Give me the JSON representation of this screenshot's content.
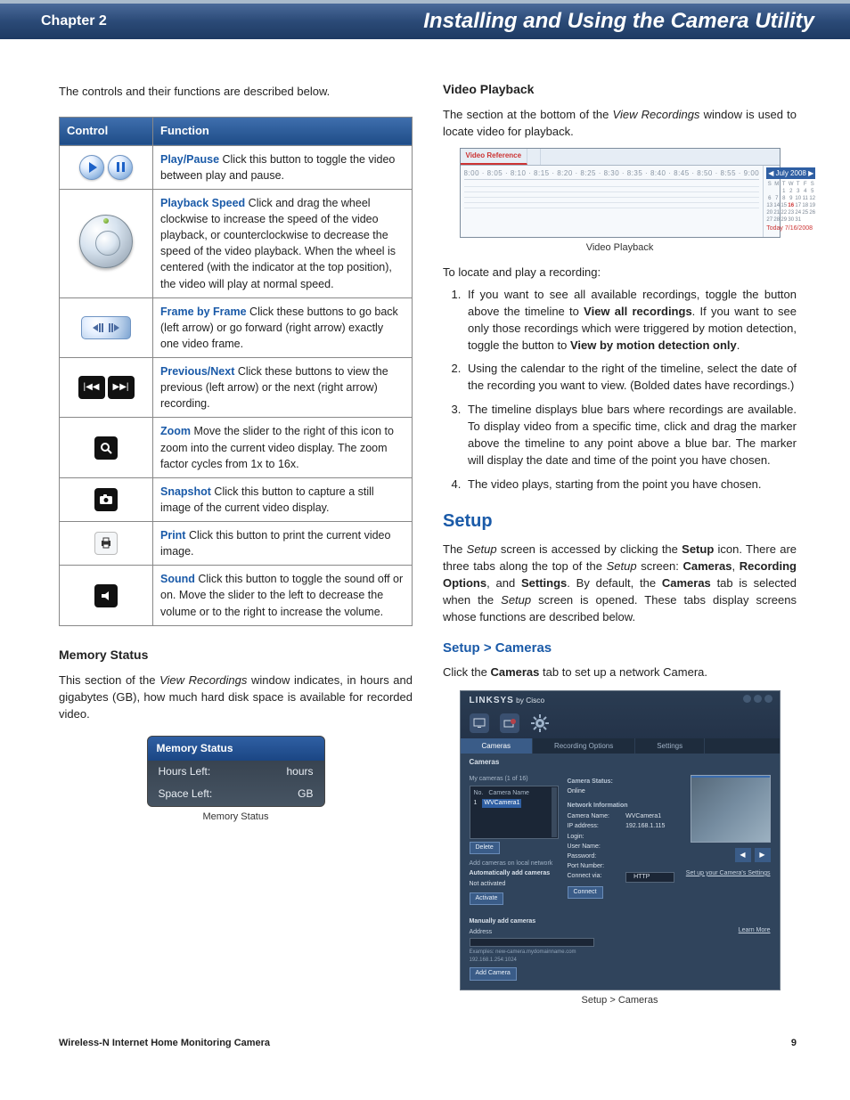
{
  "header": {
    "chapter": "Chapter 2",
    "title": "Installing and Using the Camera Utility"
  },
  "intro": "The controls and their functions are described below.",
  "table": {
    "col1": "Control",
    "col2": "Function",
    "rows": [
      {
        "icon": "play-pause-icon",
        "name": "Play/Pause",
        "desc": "  Click this button to toggle the video between play and pause."
      },
      {
        "icon": "wheel-icon",
        "name": "Playback Speed",
        "desc": " Click and drag the wheel clockwise to increase the speed of the video playback, or counterclockwise to decrease the speed of the video playback. When the wheel is centered (with the indicator at the top position), the video will play at normal speed."
      },
      {
        "icon": "frame-icon",
        "name": "Frame by Frame",
        "desc": "  Click these buttons to go back (left arrow) or go forward (right arrow) exactly one video frame."
      },
      {
        "icon": "prevnext-icon",
        "name": "Previous/Next",
        "desc": " Click these buttons to view the previous (left arrow) or the next (right arrow) recording."
      },
      {
        "icon": "zoom-icon",
        "name": "Zoom",
        "desc": " Move the slider to the right of this icon to zoom into the current video display. The zoom factor cycles from 1x to 16x."
      },
      {
        "icon": "snapshot-icon",
        "name": "Snapshot",
        "desc": "  Click this button to capture a still image of the current video display."
      },
      {
        "icon": "print-icon",
        "name": "Print",
        "desc": " Click this button to print the current video image."
      },
      {
        "icon": "sound-icon",
        "name": "Sound",
        "desc": "  Click this button to toggle the sound off or on. Move the slider to the left to decrease the volume or to the right to increase the volume."
      }
    ]
  },
  "memory": {
    "heading": "Memory Status",
    "para": "This section of the View Recordings window indicates, in hours and gigabytes (GB), how much hard disk space is available for recorded video.",
    "box_title": "Memory Status",
    "hours_label": "Hours Left:",
    "hours_unit": "hours",
    "space_label": "Space Left:",
    "space_unit": "GB",
    "caption": "Memory Status"
  },
  "videoPlayback": {
    "heading": "Video Playback",
    "para": "The section at the bottom of the View Recordings window is used to locate video for playback.",
    "caption": "Video Playback",
    "locate_intro": "To locate and play a recording:",
    "calendar_month": "July 2008",
    "calendar_today": "Today 7/16/2008",
    "tabs": {
      "active": "Video Reference",
      "ticks": "8:00 · 8:05 · 8:10 · 8:15 · 8:20 · 8:25 · 8:30 · 8:35 · 8:40 · 8:45 · 8:50 · 8:55 · 9:00"
    },
    "steps": [
      {
        "pre": "If you want to see all available recordings, toggle the button above the timeline to ",
        "b1": "View all recordings",
        "mid": ". If you want to see only those recordings which were triggered by motion detection, toggle the button to ",
        "b2": "View by motion detection only",
        "post": "."
      },
      {
        "text": "Using the calendar to the right of the timeline, select the date of the recording you want to view. (Bolded dates have recordings.)"
      },
      {
        "text": "The timeline displays blue bars where recordings are available. To display video from a specific time, click and drag the marker above the timeline to any point above a blue bar. The marker will display the date and time of the point you have chosen."
      },
      {
        "text": "The video plays, starting from the point you have chosen."
      }
    ]
  },
  "setup": {
    "heading": "Setup",
    "para_parts": {
      "p1": "The Setup screen is accessed by clicking the ",
      "b1": "Setup",
      "p2": " icon. There are three tabs along the top of the Setup screen: ",
      "b2": "Cameras",
      "p3": ", ",
      "b3": "Recording Options",
      "p4": ", and ",
      "b4": "Settings",
      "p5": ". By default, the ",
      "b5": "Cameras",
      "p6": " tab is selected when the Setup screen is opened. These tabs display screens whose functions are described below."
    },
    "sub_heading": "Setup > Cameras",
    "sub_para_pre": "Click the ",
    "sub_para_b": "Cameras",
    "sub_para_post": " tab to set up a network Camera.",
    "caption": "Setup > Cameras",
    "app": {
      "brand": "LINKSYS",
      "brand_by": " by Cisco",
      "tabs": [
        "Cameras",
        "Recording Options",
        "Settings"
      ],
      "left_title": "Cameras",
      "list_header": "My cameras (1 of 16)",
      "list_no": "No.",
      "list_name_h": "Camera Name",
      "list_item": "WVCamera1",
      "delete_btn": "Delete",
      "auto_label": "Add cameras on local network",
      "auto_sub": "Automatically add cameras",
      "auto_value": "Not activated",
      "activate_btn": "Activate",
      "manual_label": "Manually add cameras",
      "manual_sub": "Address",
      "example": "Examples: new-camera.mydomainname.com\n                192.168.1.254:1024",
      "add_btn": "Add Camera",
      "test_btn": "Learn More",
      "status_h": "Camera Status:",
      "status_v": "Online",
      "info_h": "Network Information",
      "fields": {
        "CameraName": "WVCamera1",
        "IPaddress": "192.168.1.115",
        "Login": "",
        "UserName": "",
        "Password": "",
        "Port Number": "",
        "Connect via": "HTTP"
      },
      "adv": "Set up your Camera's Settings"
    }
  },
  "footer": {
    "left": "Wireless-N Internet Home Monitoring Camera",
    "right": "9"
  }
}
